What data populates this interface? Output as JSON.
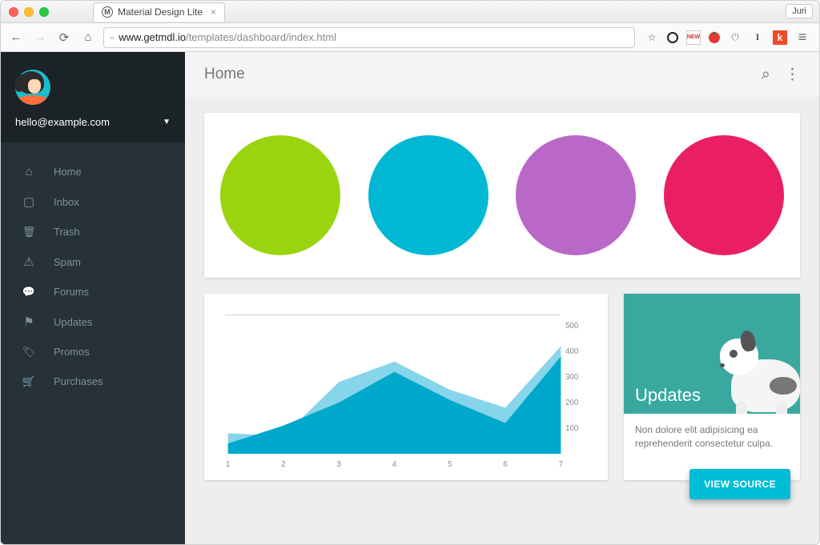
{
  "browser": {
    "tab_title": "Material Design Lite",
    "user_badge": "Juri",
    "url_host": "www.getmdl.io",
    "url_path": "/templates/dashboard/index.html"
  },
  "sidebar": {
    "email": "hello@example.com",
    "items": [
      {
        "icon": "home-icon",
        "label": "Home"
      },
      {
        "icon": "inbox-icon",
        "label": "Inbox"
      },
      {
        "icon": "trash-icon",
        "label": "Trash"
      },
      {
        "icon": "spam-icon",
        "label": "Spam"
      },
      {
        "icon": "forums-icon",
        "label": "Forums"
      },
      {
        "icon": "updates-icon",
        "label": "Updates"
      },
      {
        "icon": "promos-icon",
        "label": "Promos"
      },
      {
        "icon": "purchases-icon",
        "label": "Purchases"
      }
    ]
  },
  "appbar": {
    "title": "Home"
  },
  "circles": {
    "colors": [
      "#9ad40f",
      "#00b8d4",
      "#ba68c8",
      "#e91e63"
    ]
  },
  "chart_data": {
    "type": "line",
    "x": [
      1,
      2,
      3,
      4,
      5,
      6,
      7
    ],
    "series": [
      {
        "name": "light",
        "values": [
          80,
          70,
          280,
          360,
          250,
          180,
          420
        ]
      },
      {
        "name": "dark",
        "values": [
          40,
          110,
          200,
          320,
          210,
          120,
          380
        ]
      }
    ],
    "ylim": [
      0,
      500
    ],
    "yticks": [
      100,
      200,
      300,
      400,
      500
    ],
    "xlabel": "",
    "ylabel": "",
    "title": ""
  },
  "updates_card": {
    "title": "Updates",
    "body": "Non dolore elit adipisicing ea reprehenderit consectetur culpa."
  },
  "fab": {
    "label": "VIEW SOURCE"
  }
}
